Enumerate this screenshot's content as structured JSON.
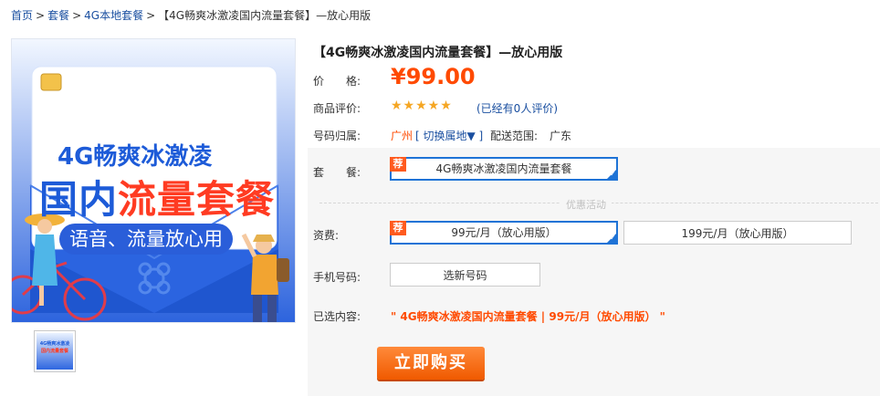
{
  "breadcrumb": {
    "home": "首页",
    "cat1": "套餐",
    "cat2": "4G本地套餐",
    "current": "【4G畅爽冰激凌国内流量套餐】—放心用版",
    "sep": ">"
  },
  "hero": {
    "line1": "4G畅爽冰激凌",
    "line2a": "国内",
    "line2b": "流量套餐",
    "line3": "语音、流量放心用"
  },
  "thumb": {
    "line1": "4G畅爽冰激凌",
    "line2": "国内流量套餐"
  },
  "product": {
    "title": "【4G畅爽冰激凌国内流量套餐】—放心用版",
    "price_label": "价　　格:",
    "price": "¥99.00",
    "rating_label": "商品评价:",
    "rating_stars": 5,
    "stars_text": "★★★★★",
    "review_text": "(已经有0人评价)",
    "region_label": "号码归属:",
    "region": "广州",
    "switch_text": "[ 切换属地▼ ]",
    "ship_label": "配送范围:",
    "ship_value": "广东"
  },
  "options": {
    "package_label": "套　　餐:",
    "package_option": "4G畅爽冰激凌国内流量套餐",
    "divider_text": "优惠活动",
    "fee_label": "资费:",
    "fee_options": [
      "99元/月（放心用版）",
      "199元/月（放心用版）"
    ],
    "recommend_badge": "荐",
    "phone_label": "手机号码:",
    "phone_button": "选新号码",
    "selected_label": "已选内容:",
    "selected_text": "\"  4G畅爽冰激凌国内流量套餐    | 99元/月（放心用版）     \"",
    "buy_button": "立即购买"
  },
  "colors": {
    "accent_orange": "#ff4a00",
    "link_blue": "#1a4fa0",
    "select_blue": "#1e73d6"
  }
}
